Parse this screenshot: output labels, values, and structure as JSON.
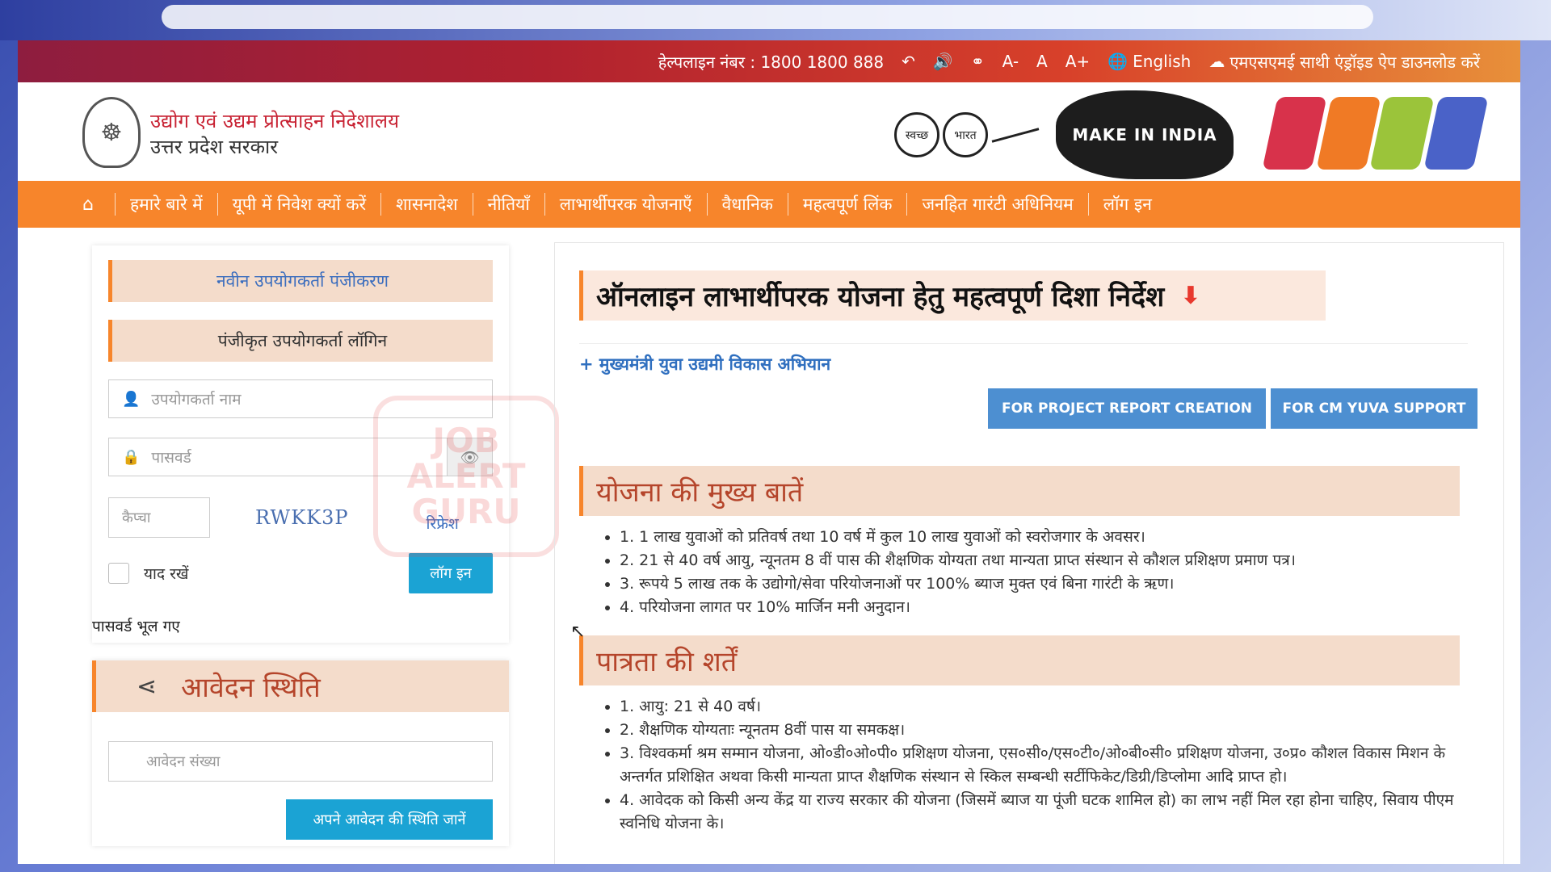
{
  "topbar": {
    "helpline": "हेल्पलाइन नंबर : 1800 1800 888",
    "font_small": "A-",
    "font_normal": "A",
    "font_large": "A+",
    "language": "English",
    "app_download": "एमएसएमई साथी एंड्रॉइड ऐप डाउनलोड करें",
    "icons": [
      "back-icon",
      "speaker-icon",
      "sitemap-icon",
      "language-icon",
      "cloud-download-icon"
    ]
  },
  "header": {
    "org_line1": "उद्योग एवं उद्यम प्रोत्साहन निदेशालय",
    "org_line2": "उत्तर प्रदेश सरकार",
    "swachh_1": "स्वच्छ",
    "swachh_2": "भारत",
    "make_in_india": "MAKE IN INDIA"
  },
  "nav": {
    "items": [
      "हमारे बारे में",
      "यूपी में निवेश क्यों करें",
      "शासनादेश",
      "नीतियाँ",
      "लाभार्थीपरक योजनाएँ",
      "वैधानिक",
      "महत्वपूर्ण लिंक",
      "जनहित गारंटी अधिनियम",
      "लॉग इन"
    ]
  },
  "left": {
    "new_registration": "नवीन उपयोगकर्ता पंजीकरण",
    "registered_login": "पंजीकृत उपयोगकर्ता लॉगिन",
    "username_placeholder": "उपयोगकर्ता नाम",
    "password_placeholder": "पासवर्ड",
    "captcha_placeholder": "कैप्चा",
    "captcha_code": "RWKK3P",
    "refresh": "रिफ्रेश",
    "remember": "याद रखें",
    "login_button": "लॉग इन",
    "forgot_password": "पासवर्ड भूल गए",
    "status_title": "आवेदन स्थिति",
    "application_no_placeholder": "आवेदन संख्या",
    "status_button": "अपने आवेदन की स्थिति जानें"
  },
  "watermark": {
    "line1": "JOB",
    "line2": "ALERT",
    "line3": "GURU"
  },
  "main": {
    "title": "ऑनलाइन लाभार्थीपरक योजना हेतु महत्वपूर्ण दिशा निर्देश",
    "scheme_link": "+ मुख्यमंत्री युवा उद्यमी विकास अभियान",
    "btn_project_report": "FOR PROJECT REPORT CREATION",
    "btn_cm_yuva": "FOR CM YUVA SUPPORT",
    "highlights_title": "योजना की मुख्य बातें",
    "highlights": [
      "1. 1 लाख युवाओं को प्रतिवर्ष तथा 10 वर्ष में कुल 10 लाख युवाओं को स्वरोजगार के अवसर।",
      "2. 21 से 40 वर्ष आयु, न्यूनतम 8 वीं पास की शैक्षणिक योग्यता तथा मान्यता प्राप्त संस्थान से कौशल प्रशिक्षण प्रमाण पत्र।",
      "3. रूपये 5 लाख तक के उद्योगो/सेवा परियोजनाओं पर 100% ब्याज मुक्त एवं बिना गारंटी के ऋण।",
      "4. परियोजना लागत पर 10% मार्जिन मनी अनुदान।"
    ],
    "eligibility_title": "पात्रता की शर्तें",
    "eligibility": [
      "1. आयु: 21 से 40 वर्ष।",
      "2. शैक्षणिक योग्यताः न्यूनतम 8वीं पास या समकक्ष।",
      "3. विश्वकर्मा श्रम सम्मान योजना, ओ०डी०ओ०पी० प्रशिक्षण योजना, एस०सी०/एस०टी०/ओ०बी०सी० प्रशिक्षण योजना, उ०प्र० कौशल विकास मिशन के अन्तर्गत प्रशिक्षित अथवा किसी मान्यता प्राप्त शैक्षणिक संस्थान से स्किल सम्बन्धी सर्टीफिकेट/डिग्री/डिप्लोमा आदि प्राप्त हो।",
      "4. आवेदक को किसी अन्य केंद्र या राज्य सरकार की योजना (जिसमें ब्याज या पूंजी घटक शामिल हो) का लाभ नहीं मिल रहा होना चाहिए, सिवाय पीएम स्वनिधि योजना के।"
    ]
  },
  "colors": {
    "topbar_start": "#8e1d3f",
    "topbar_end": "#e8903a",
    "nav_orange": "#f7852b",
    "button_blue": "#1ba3d4",
    "cta_blue": "#4d8fd1",
    "section_bg": "#f4dccb",
    "section_text": "#b5452b"
  }
}
